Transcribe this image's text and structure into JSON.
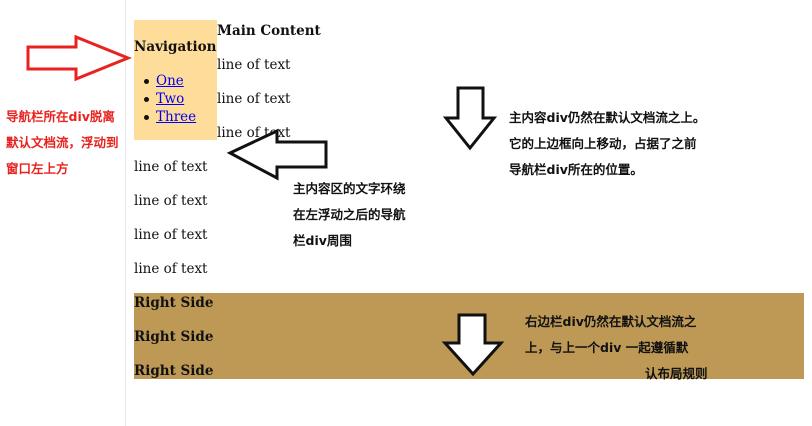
{
  "navigation": {
    "title": "Navigation",
    "items": [
      "One",
      "Two",
      "Three"
    ]
  },
  "main": {
    "title": "Main Content",
    "lines": [
      "line of text",
      "line of text",
      "line of text",
      "line of text",
      "line of text",
      "line of text",
      "line of text"
    ]
  },
  "right_side": {
    "lines": [
      "Right Side",
      "Right Side",
      "Right Side"
    ]
  },
  "annotations": {
    "nav_note": [
      "导航栏所在div脱离",
      "默认文档流，浮动到",
      "窗口左上方"
    ],
    "wrap_note": [
      "主内容区的文字环绕",
      "在左浮动之后的导航",
      "栏div周围"
    ],
    "main_note": [
      "主内容div仍然在默认文档流之上。",
      "它的上边框向上移动，占据了之前",
      "导航栏div所在的位置。"
    ],
    "right_note": [
      "右边栏div仍然在默认文档流之",
      "上，与上一个div 一起遵循默",
      "认布局规则"
    ]
  },
  "colors": {
    "nav_bg": "#fedc9a",
    "right_side_bg": "#bd9955",
    "note_red": "#e8231f",
    "link": "#0000ee"
  }
}
